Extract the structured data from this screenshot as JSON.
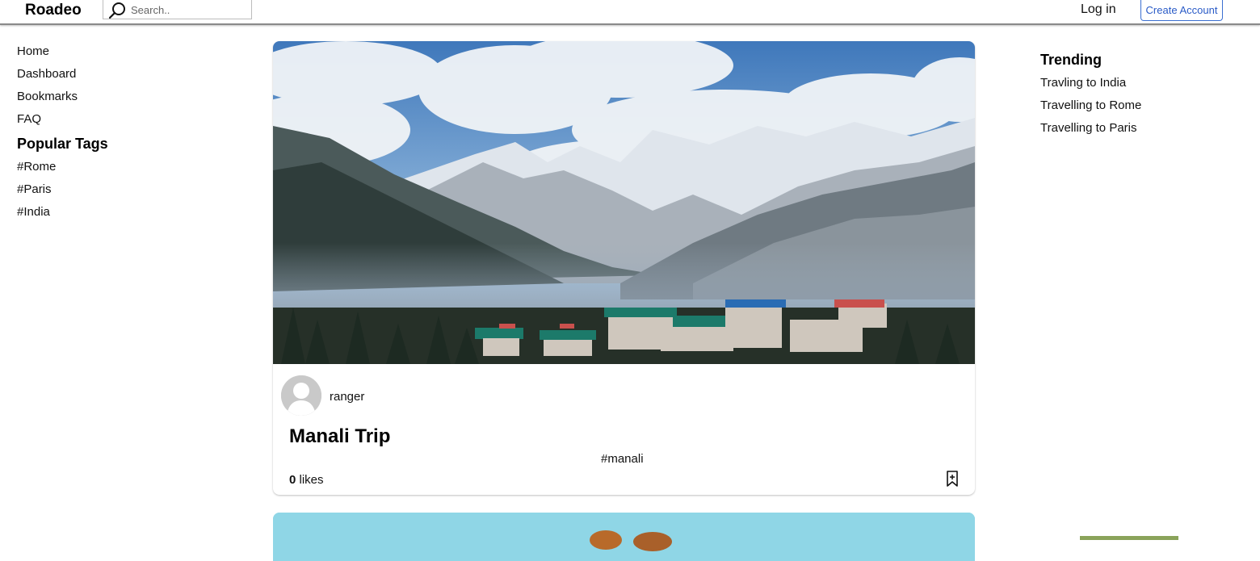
{
  "header": {
    "brand": "Roadeo",
    "search_placeholder": "Search..",
    "login_label": "Log in",
    "create_account_label": "Create Account"
  },
  "sidebar": {
    "items": [
      {
        "label": "Home"
      },
      {
        "label": "Dashboard"
      },
      {
        "label": "Bookmarks"
      },
      {
        "label": "FAQ"
      }
    ],
    "tags_heading": "Popular Tags",
    "tags": [
      {
        "label": "#Rome"
      },
      {
        "label": "#Paris"
      },
      {
        "label": "#India"
      }
    ]
  },
  "trending": {
    "heading": "Trending",
    "items": [
      {
        "label": "Travling to India"
      },
      {
        "label": "Travelling to Rome"
      },
      {
        "label": "Travelling to Paris"
      }
    ]
  },
  "post": {
    "author": "ranger",
    "title": "Manali Trip",
    "tag": "#manali",
    "likes_count": "0",
    "likes_label": "likes"
  },
  "colors": {
    "accent": "#2a5bc7",
    "sky": "#4f86c6",
    "snow": "#eef1f4",
    "forest": "#34433f"
  },
  "icons": [
    "search-icon",
    "avatar-icon",
    "bookmark-icon"
  ]
}
